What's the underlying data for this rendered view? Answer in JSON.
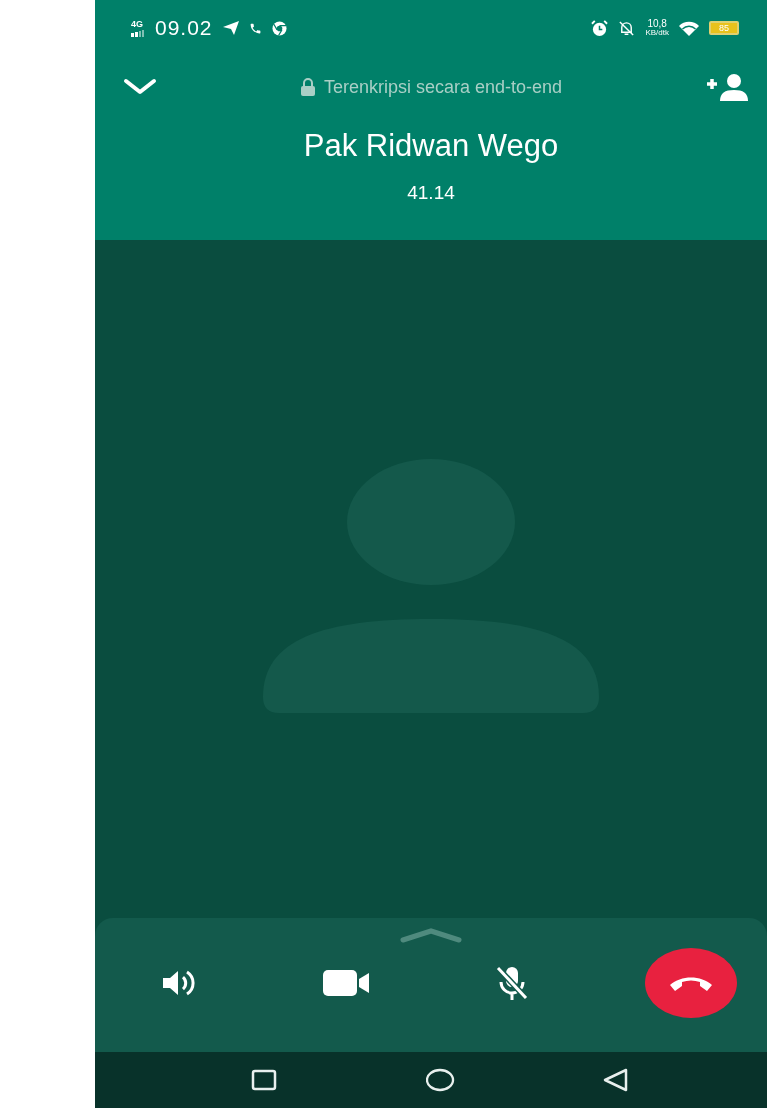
{
  "status_bar": {
    "network": "4G",
    "time": "09.02",
    "speed": "10,8",
    "speed_unit": "KB/dtk",
    "battery": "85"
  },
  "header": {
    "encryption": "Terenkripsi secara end-to-end",
    "caller": "Pak Ridwan Wego",
    "duration": "41.14"
  },
  "controls": [
    {
      "kind": "speaker"
    },
    {
      "kind": "video"
    },
    {
      "kind": "mute"
    },
    {
      "kind": "end"
    }
  ],
  "nav": [
    {
      "kind": "recent"
    },
    {
      "kind": "home"
    },
    {
      "kind": "back"
    }
  ]
}
